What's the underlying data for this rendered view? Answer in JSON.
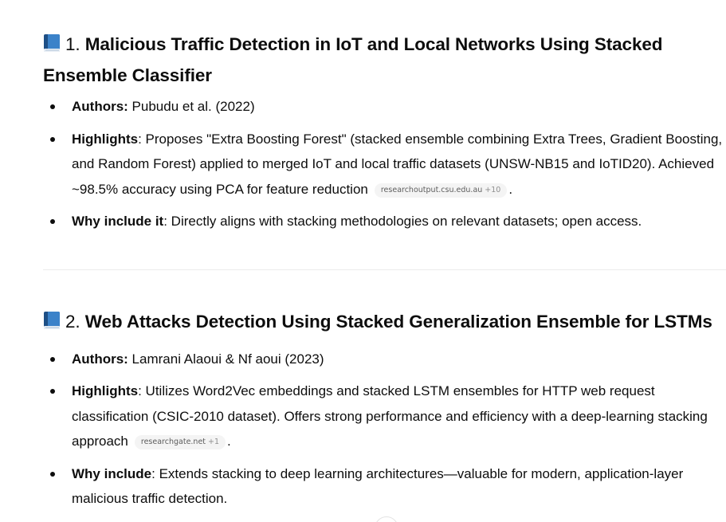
{
  "sections": [
    {
      "icon": "blue-book-icon",
      "number": "1.",
      "title": "Malicious Traffic Detection in IoT and Local Networks Using Stacked Ensemble Classifier",
      "bullets": [
        {
          "label": "Authors:",
          "text": " Pubudu et al. (2022)"
        },
        {
          "label": "Highlights",
          "text": ": Proposes \"Extra Boosting Forest\" (stacked ensemble combining Extra Trees, Gradient Boosting, and Random Forest) applied to merged IoT and local traffic datasets (UNSW-NB15 and IoTID20). Achieved ~98.5% accuracy using PCA for feature reduction",
          "chip": {
            "source": "researchoutput.csu.edu.au",
            "more": "+10"
          },
          "tail": "."
        },
        {
          "label": "Why include it",
          "text": ": Directly aligns with stacking methodologies on relevant datasets; open access."
        }
      ]
    },
    {
      "icon": "blue-book-icon",
      "number": "2.",
      "title": "Web Attacks Detection Using Stacked Generalization Ensemble for LSTMs",
      "bullets": [
        {
          "label": "Authors:",
          "text": " Lamrani Alaoui & Nf aoui (2023)"
        },
        {
          "label": "Highlights",
          "text": ": Utilizes Word2Vec embeddings and stacked LSTM ensembles for HTTP web request classification (CSIC-2010 dataset). Offers strong performance and efficiency with a deep-learning stacking approach",
          "chip": {
            "source": "researchgate.net",
            "more": "+1"
          },
          "tail": "."
        },
        {
          "label": "Why include",
          "text": ": Extends stacking to deep learning architectures—valuable for modern, application-layer malicious traffic detection."
        }
      ]
    }
  ],
  "colors": {
    "text": "#0d0d0d",
    "chip_bg": "#f4f4f4",
    "chip_text": "#5d5d5d",
    "book_blue": "#2f6fb3",
    "divider": "#ececec"
  }
}
